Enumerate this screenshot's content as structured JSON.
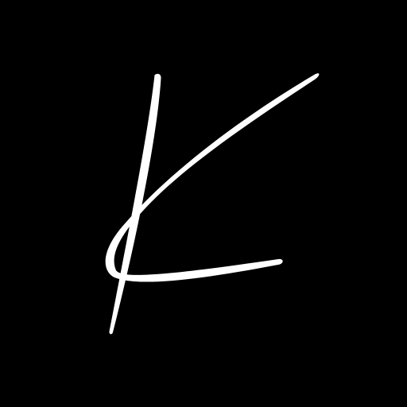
{
  "logo": {
    "letter": "K",
    "style": "handwritten signature monogram",
    "icon": "k-monogram-icon"
  },
  "colors": {
    "background": "#000000",
    "stroke": "#ffffff"
  }
}
